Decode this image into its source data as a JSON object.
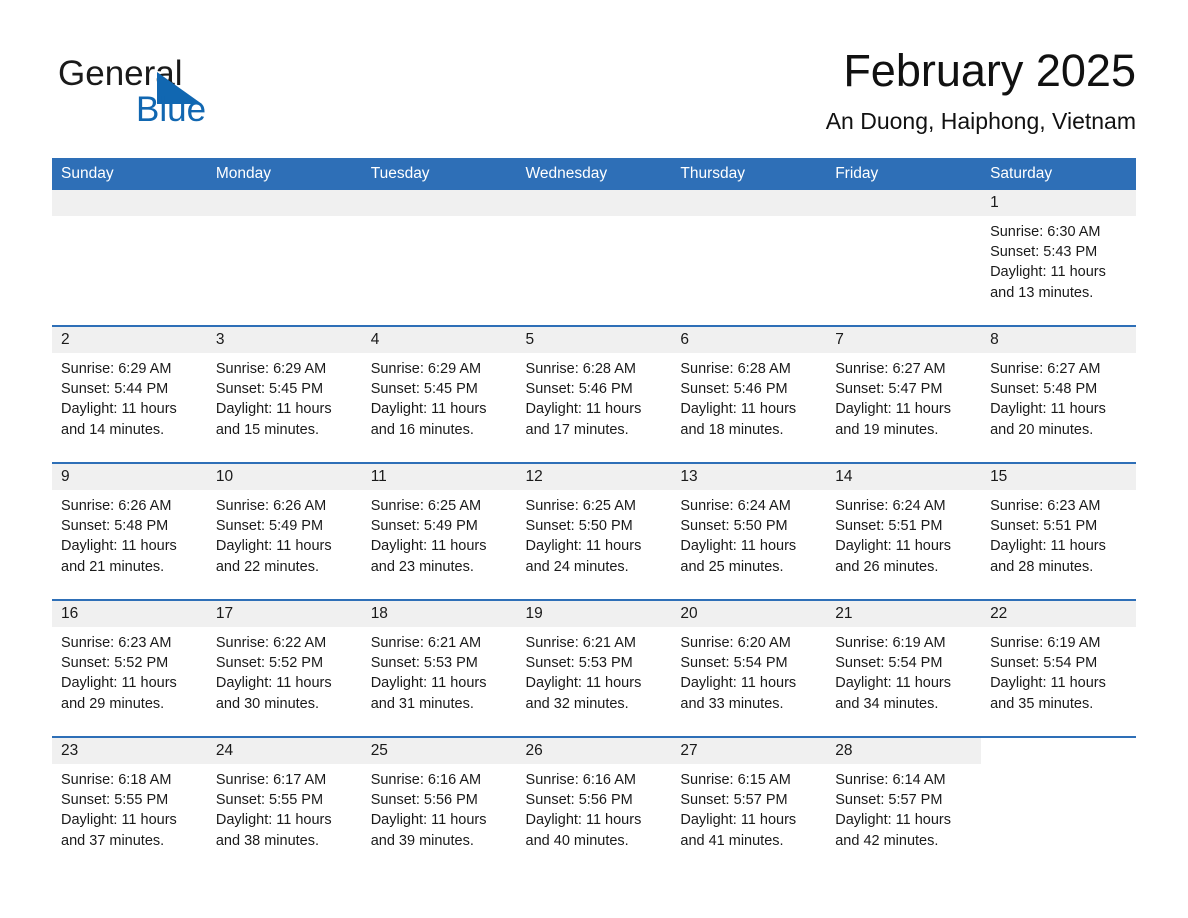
{
  "brand": {
    "name_part1": "General",
    "name_part2": "Blue",
    "triangle_color": "#1167b1",
    "text_color": "#1a1a1a"
  },
  "header": {
    "month_title": "February 2025",
    "location": "An Duong, Haiphong, Vietnam",
    "accent_color": "#2e6fb7",
    "daynum_band_color": "#f0f0f0"
  },
  "calendar": {
    "weekday_headers": [
      "Sunday",
      "Monday",
      "Tuesday",
      "Wednesday",
      "Thursday",
      "Friday",
      "Saturday"
    ],
    "weeks": [
      [
        {
          "day": "",
          "empty": true
        },
        {
          "day": "",
          "empty": true
        },
        {
          "day": "",
          "empty": true
        },
        {
          "day": "",
          "empty": true
        },
        {
          "day": "",
          "empty": true
        },
        {
          "day": "",
          "empty": true
        },
        {
          "day": "1",
          "sunrise": "Sunrise: 6:30 AM",
          "sunset": "Sunset: 5:43 PM",
          "daylight_line1": "Daylight: 11 hours",
          "daylight_line2": "and 13 minutes."
        }
      ],
      [
        {
          "day": "2",
          "sunrise": "Sunrise: 6:29 AM",
          "sunset": "Sunset: 5:44 PM",
          "daylight_line1": "Daylight: 11 hours",
          "daylight_line2": "and 14 minutes."
        },
        {
          "day": "3",
          "sunrise": "Sunrise: 6:29 AM",
          "sunset": "Sunset: 5:45 PM",
          "daylight_line1": "Daylight: 11 hours",
          "daylight_line2": "and 15 minutes."
        },
        {
          "day": "4",
          "sunrise": "Sunrise: 6:29 AM",
          "sunset": "Sunset: 5:45 PM",
          "daylight_line1": "Daylight: 11 hours",
          "daylight_line2": "and 16 minutes."
        },
        {
          "day": "5",
          "sunrise": "Sunrise: 6:28 AM",
          "sunset": "Sunset: 5:46 PM",
          "daylight_line1": "Daylight: 11 hours",
          "daylight_line2": "and 17 minutes."
        },
        {
          "day": "6",
          "sunrise": "Sunrise: 6:28 AM",
          "sunset": "Sunset: 5:46 PM",
          "daylight_line1": "Daylight: 11 hours",
          "daylight_line2": "and 18 minutes."
        },
        {
          "day": "7",
          "sunrise": "Sunrise: 6:27 AM",
          "sunset": "Sunset: 5:47 PM",
          "daylight_line1": "Daylight: 11 hours",
          "daylight_line2": "and 19 minutes."
        },
        {
          "day": "8",
          "sunrise": "Sunrise: 6:27 AM",
          "sunset": "Sunset: 5:48 PM",
          "daylight_line1": "Daylight: 11 hours",
          "daylight_line2": "and 20 minutes."
        }
      ],
      [
        {
          "day": "9",
          "sunrise": "Sunrise: 6:26 AM",
          "sunset": "Sunset: 5:48 PM",
          "daylight_line1": "Daylight: 11 hours",
          "daylight_line2": "and 21 minutes."
        },
        {
          "day": "10",
          "sunrise": "Sunrise: 6:26 AM",
          "sunset": "Sunset: 5:49 PM",
          "daylight_line1": "Daylight: 11 hours",
          "daylight_line2": "and 22 minutes."
        },
        {
          "day": "11",
          "sunrise": "Sunrise: 6:25 AM",
          "sunset": "Sunset: 5:49 PM",
          "daylight_line1": "Daylight: 11 hours",
          "daylight_line2": "and 23 minutes."
        },
        {
          "day": "12",
          "sunrise": "Sunrise: 6:25 AM",
          "sunset": "Sunset: 5:50 PM",
          "daylight_line1": "Daylight: 11 hours",
          "daylight_line2": "and 24 minutes."
        },
        {
          "day": "13",
          "sunrise": "Sunrise: 6:24 AM",
          "sunset": "Sunset: 5:50 PM",
          "daylight_line1": "Daylight: 11 hours",
          "daylight_line2": "and 25 minutes."
        },
        {
          "day": "14",
          "sunrise": "Sunrise: 6:24 AM",
          "sunset": "Sunset: 5:51 PM",
          "daylight_line1": "Daylight: 11 hours",
          "daylight_line2": "and 26 minutes."
        },
        {
          "day": "15",
          "sunrise": "Sunrise: 6:23 AM",
          "sunset": "Sunset: 5:51 PM",
          "daylight_line1": "Daylight: 11 hours",
          "daylight_line2": "and 28 minutes."
        }
      ],
      [
        {
          "day": "16",
          "sunrise": "Sunrise: 6:23 AM",
          "sunset": "Sunset: 5:52 PM",
          "daylight_line1": "Daylight: 11 hours",
          "daylight_line2": "and 29 minutes."
        },
        {
          "day": "17",
          "sunrise": "Sunrise: 6:22 AM",
          "sunset": "Sunset: 5:52 PM",
          "daylight_line1": "Daylight: 11 hours",
          "daylight_line2": "and 30 minutes."
        },
        {
          "day": "18",
          "sunrise": "Sunrise: 6:21 AM",
          "sunset": "Sunset: 5:53 PM",
          "daylight_line1": "Daylight: 11 hours",
          "daylight_line2": "and 31 minutes."
        },
        {
          "day": "19",
          "sunrise": "Sunrise: 6:21 AM",
          "sunset": "Sunset: 5:53 PM",
          "daylight_line1": "Daylight: 11 hours",
          "daylight_line2": "and 32 minutes."
        },
        {
          "day": "20",
          "sunrise": "Sunrise: 6:20 AM",
          "sunset": "Sunset: 5:54 PM",
          "daylight_line1": "Daylight: 11 hours",
          "daylight_line2": "and 33 minutes."
        },
        {
          "day": "21",
          "sunrise": "Sunrise: 6:19 AM",
          "sunset": "Sunset: 5:54 PM",
          "daylight_line1": "Daylight: 11 hours",
          "daylight_line2": "and 34 minutes."
        },
        {
          "day": "22",
          "sunrise": "Sunrise: 6:19 AM",
          "sunset": "Sunset: 5:54 PM",
          "daylight_line1": "Daylight: 11 hours",
          "daylight_line2": "and 35 minutes."
        }
      ],
      [
        {
          "day": "23",
          "sunrise": "Sunrise: 6:18 AM",
          "sunset": "Sunset: 5:55 PM",
          "daylight_line1": "Daylight: 11 hours",
          "daylight_line2": "and 37 minutes."
        },
        {
          "day": "24",
          "sunrise": "Sunrise: 6:17 AM",
          "sunset": "Sunset: 5:55 PM",
          "daylight_line1": "Daylight: 11 hours",
          "daylight_line2": "and 38 minutes."
        },
        {
          "day": "25",
          "sunrise": "Sunrise: 6:16 AM",
          "sunset": "Sunset: 5:56 PM",
          "daylight_line1": "Daylight: 11 hours",
          "daylight_line2": "and 39 minutes."
        },
        {
          "day": "26",
          "sunrise": "Sunrise: 6:16 AM",
          "sunset": "Sunset: 5:56 PM",
          "daylight_line1": "Daylight: 11 hours",
          "daylight_line2": "and 40 minutes."
        },
        {
          "day": "27",
          "sunrise": "Sunrise: 6:15 AM",
          "sunset": "Sunset: 5:57 PM",
          "daylight_line1": "Daylight: 11 hours",
          "daylight_line2": "and 41 minutes."
        },
        {
          "day": "28",
          "sunrise": "Sunrise: 6:14 AM",
          "sunset": "Sunset: 5:57 PM",
          "daylight_line1": "Daylight: 11 hours",
          "daylight_line2": "and 42 minutes."
        },
        {
          "day": "",
          "empty": true,
          "trailing": true
        }
      ]
    ]
  }
}
